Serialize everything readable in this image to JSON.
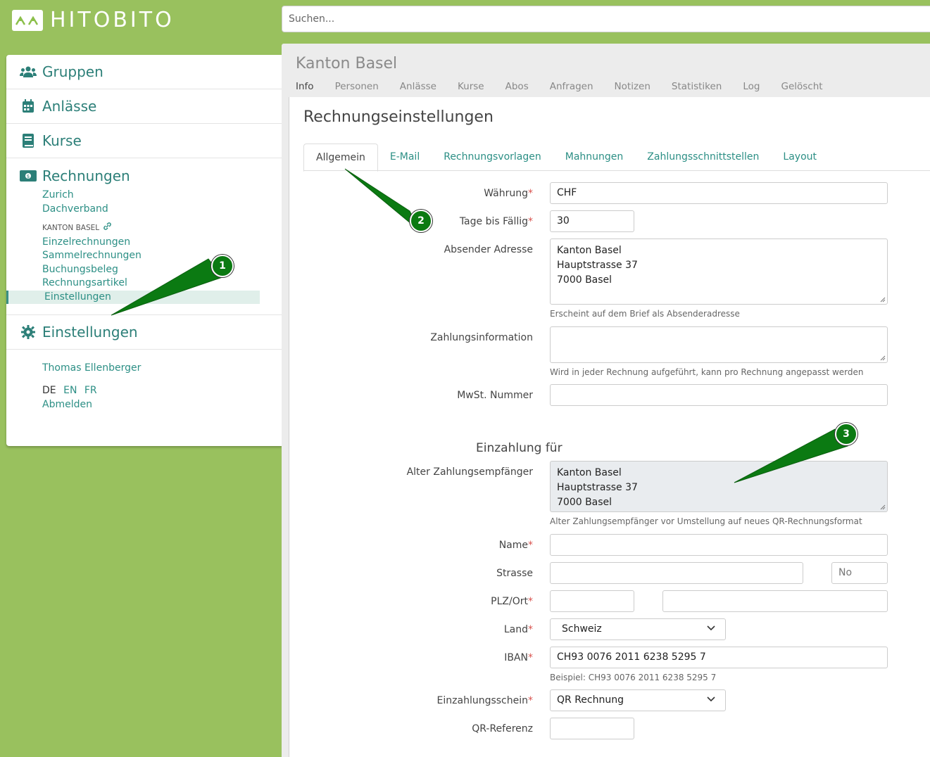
{
  "header": {
    "brand": "HITOBITO",
    "search_placeholder": "Suchen..."
  },
  "sidebar": {
    "nav": [
      {
        "label": "Gruppen",
        "icon": "users-icon"
      },
      {
        "label": "Anlässe",
        "icon": "calendar-icon"
      },
      {
        "label": "Kurse",
        "icon": "book-icon"
      },
      {
        "label": "Rechnungen",
        "icon": "money-bill-icon"
      }
    ],
    "invoice_groups": [
      "Zurich",
      "Dachverband"
    ],
    "section_label": "KANTON BASEL",
    "invoice_links": [
      "Einzelrechnungen",
      "Sammelrechnungen",
      "Buchungsbeleg",
      "Rechnungsartikel",
      "Einstellungen"
    ],
    "settings_label": "Einstellungen",
    "user": "Thomas Ellenberger",
    "lang_current": "DE",
    "lang_en": "EN",
    "lang_fr": "FR",
    "logout": "Abmelden"
  },
  "main": {
    "group_title": "Kanton Basel",
    "group_tabs": [
      "Info",
      "Personen",
      "Anlässe",
      "Kurse",
      "Abos",
      "Anfragen",
      "Notizen",
      "Statistiken",
      "Log",
      "Gelöscht"
    ],
    "page_title": "Rechnungseinstellungen",
    "tabs": [
      "Allgemein",
      "E-Mail",
      "Rechnungsvorlagen",
      "Mahnungen",
      "Zahlungsschnittstellen",
      "Layout"
    ]
  },
  "form": {
    "currency_label": "Währung",
    "currency_value": "CHF",
    "due_days_label": "Tage bis Fällig",
    "due_days_value": "30",
    "sender_label": "Absender Adresse",
    "sender_value": "Kanton Basel\nHauptstrasse 37\n7000 Basel",
    "sender_help": "Erscheint auf dem Brief als Absenderadresse",
    "payment_info_label": "Zahlungsinformation",
    "payment_info_help": "Wird in jeder Rechnung aufgeführt, kann pro Rechnung angepasst werden",
    "vat_label": "MwSt. Nummer",
    "payee_heading": "Einzahlung für",
    "old_payee_label": "Alter Zahlungsempfänger",
    "old_payee_value": "Kanton Basel\nHauptstrasse 37\n7000 Basel",
    "old_payee_help": "Alter Zahlungsempfänger vor Umstellung auf neues QR-Rechnungsformat",
    "name_label": "Name",
    "street_label": "Strasse",
    "street_no_placeholder": "No",
    "zip_city_label": "PLZ/Ort",
    "country_label": "Land",
    "country_value": "Schweiz",
    "iban_label": "IBAN",
    "iban_value": "CH93 0076 2011 6238 5295 7",
    "iban_help": "Beispiel: CH93 0076 2011 6238 5295 7",
    "slip_label": "Einzahlungsschein",
    "slip_value": "QR Rechnung",
    "qr_ref_label": "QR-Referenz"
  },
  "callouts": [
    "1",
    "2",
    "3"
  ],
  "colors": {
    "page_bg": "#99c15e",
    "accent": "#2c8f85",
    "callout": "#0b7a12"
  }
}
